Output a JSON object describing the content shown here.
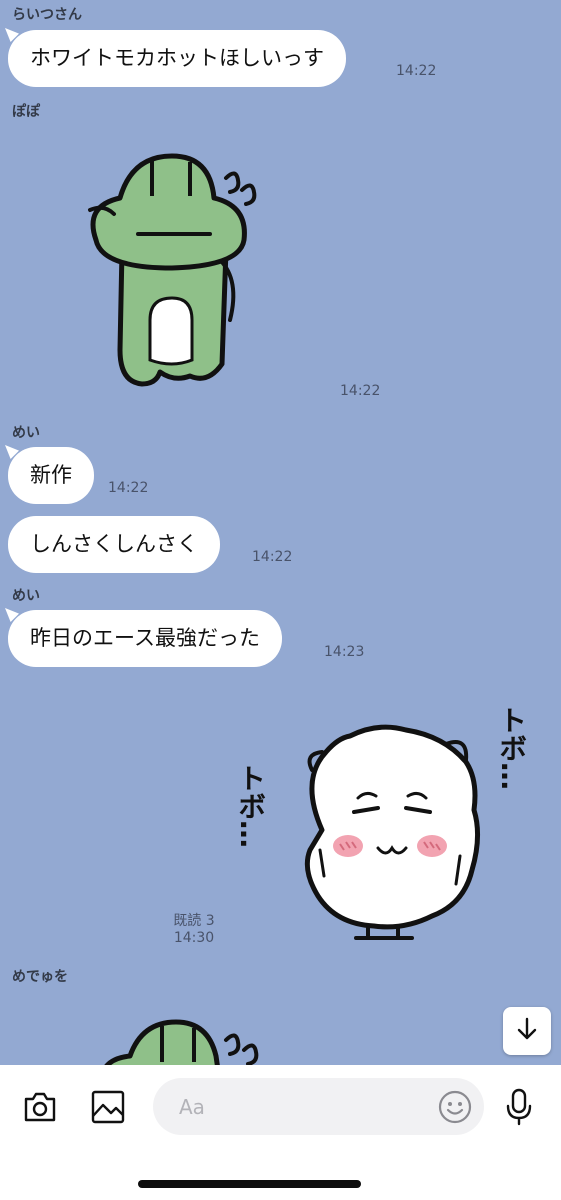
{
  "messages": [
    {
      "sender": "らいつさん",
      "text": "ホワイトモカホットほしいっす",
      "time": "14:22"
    },
    {
      "sender": "ぽぽ",
      "sticker": "frog-sticker",
      "time": "14:22"
    },
    {
      "sender": "めい",
      "text": "新作",
      "time": "14:22"
    },
    {
      "text": "しんさくしんさく",
      "time": "14:22"
    },
    {
      "sender": "めい",
      "text": "昨日のエース最強だった",
      "time": "14:23"
    },
    {
      "sticker": "white-creature-sticker",
      "sticker_text": [
        "トボ…",
        "トボ…"
      ],
      "read": "既読 3",
      "time": "14:30"
    },
    {
      "sender": "めでゅを",
      "sticker": "frog-sticker"
    }
  ],
  "composer": {
    "placeholder": "Aa",
    "icons": [
      "camera-icon",
      "image-icon",
      "emoji-icon",
      "microphone-icon"
    ]
  },
  "scroll_button": {
    "icon": "arrow-down-icon"
  },
  "colors": {
    "chat_background": "#93a9d2",
    "bubble": "#ffffff",
    "frog": "#8fc089",
    "blush": "#f2a3b1"
  }
}
